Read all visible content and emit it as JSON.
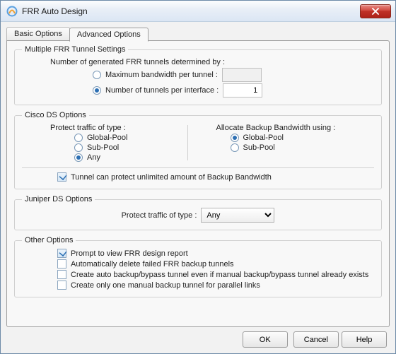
{
  "window": {
    "title": "FRR Auto Design"
  },
  "tabs": {
    "basic": "Basic Options",
    "advanced": "Advanced Options",
    "active": "advanced"
  },
  "multiFrr": {
    "legend": "Multiple FRR Tunnel Settings",
    "intro": "Number of generated FRR tunnels determined by :",
    "optMaxBw": "Maximum bandwidth per tunnel :",
    "optNumIf": "Number of tunnels per interface :",
    "maxBwVal": "",
    "numIfVal": "1"
  },
  "ciscoDs": {
    "legend": "Cisco DS Options",
    "protectLabel": "Protect traffic of type :",
    "protect": {
      "global": "Global-Pool",
      "sub": "Sub-Pool",
      "any": "Any"
    },
    "allocLabel": "Allocate Backup Bandwidth using :",
    "alloc": {
      "global": "Global-Pool",
      "sub": "Sub-Pool"
    },
    "unlimited": "Tunnel can protect unlimited amount of Backup Bandwidth"
  },
  "juniperDs": {
    "legend": "Juniper DS Options",
    "protectLabel": "Protect traffic of type :",
    "options": [
      "Any"
    ],
    "selected": "Any"
  },
  "other": {
    "legend": "Other Options",
    "prompt": "Prompt to view FRR design report",
    "autoDelete": "Automatically delete failed FRR backup tunnels",
    "createAuto": "Create auto backup/bypass tunnel even if manual backup/bypass tunnel already exists",
    "createOne": "Create only one manual backup tunnel for parallel links"
  },
  "buttons": {
    "ok": "OK",
    "cancel": "Cancel",
    "help": "Help"
  }
}
